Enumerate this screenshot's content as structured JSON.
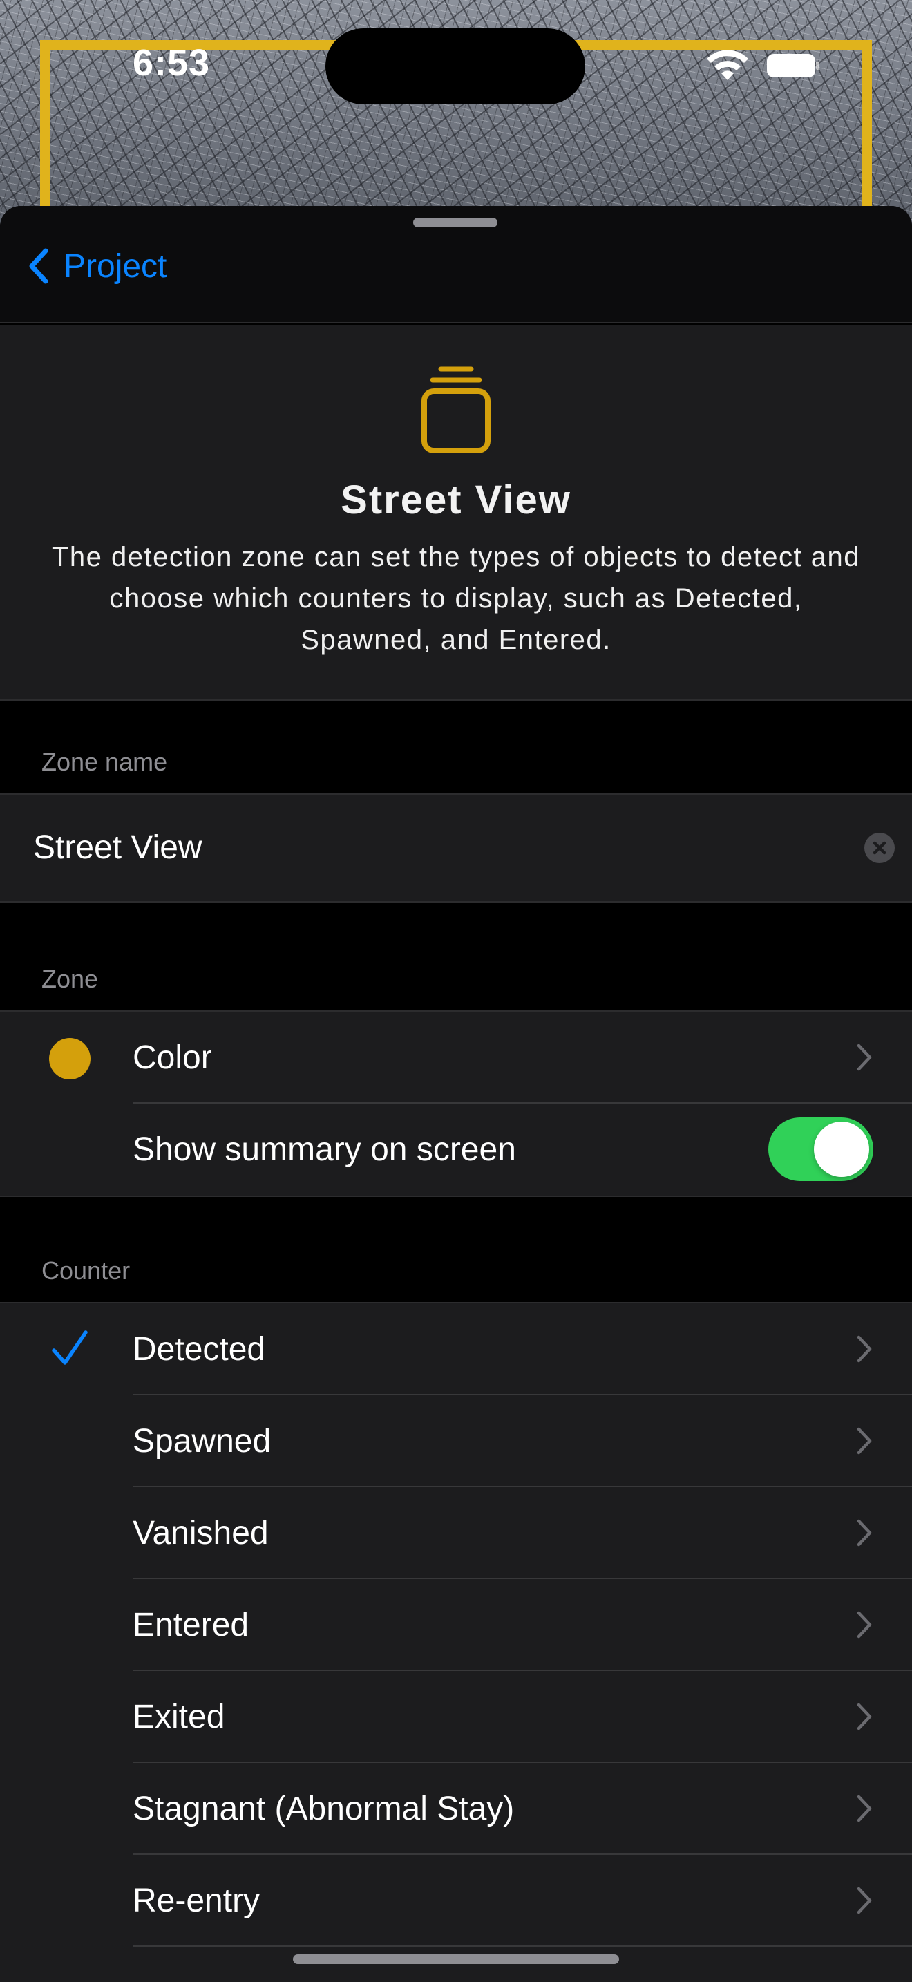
{
  "status_bar": {
    "time": "6:53"
  },
  "nav": {
    "back_label": "Project"
  },
  "header": {
    "icon": "zone-stack-icon",
    "title": "Street View",
    "description": "The detection zone can set the types of objects to detect and choose which counters to display, such as Detected, Spawned, and Entered."
  },
  "zone_name": {
    "section_label": "Zone name",
    "value": "Street View"
  },
  "zone": {
    "section_label": "Zone",
    "color_label": "Color",
    "color_value": "#d4a00c",
    "summary_label": "Show summary on screen",
    "summary_enabled": true
  },
  "counter": {
    "section_label": "Counter",
    "items": [
      {
        "label": "Detected",
        "checked": true
      },
      {
        "label": "Spawned",
        "checked": false
      },
      {
        "label": "Vanished",
        "checked": false
      },
      {
        "label": "Entered",
        "checked": false
      },
      {
        "label": "Exited",
        "checked": false
      },
      {
        "label": "Stagnant (Abnormal Stay)",
        "checked": false
      },
      {
        "label": "Re-entry",
        "checked": false
      }
    ]
  },
  "colors": {
    "accent": "#0a84ff",
    "zone_yellow": "#e0b31c",
    "toggle_on": "#30d158"
  }
}
